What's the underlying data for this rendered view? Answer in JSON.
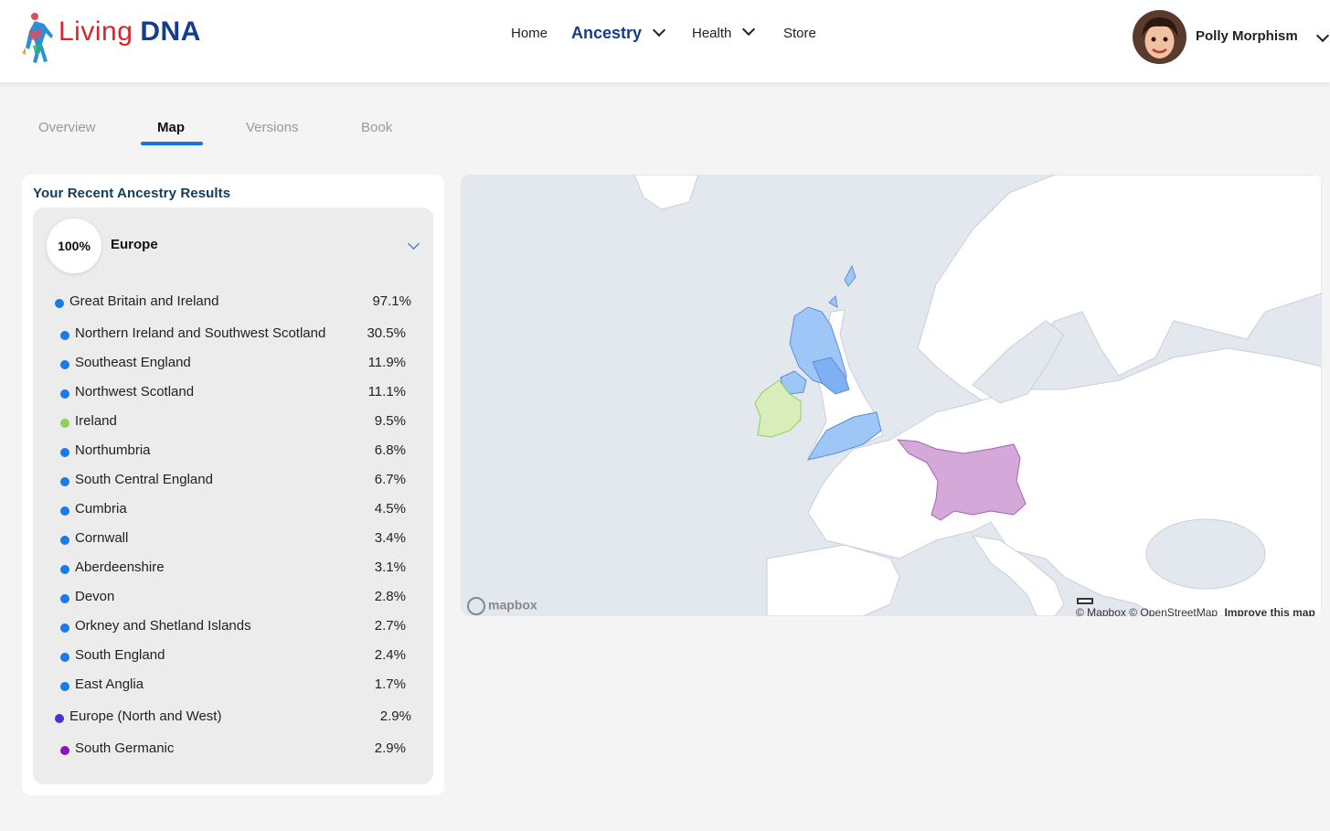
{
  "header": {
    "logo_part1": "Living",
    "logo_part2": "DNA",
    "nav": [
      {
        "label": "Home",
        "has_dropdown": false,
        "active": false
      },
      {
        "label": "Ancestry",
        "has_dropdown": true,
        "active": true
      },
      {
        "label": "Health",
        "has_dropdown": true,
        "active": false
      },
      {
        "label": "Store",
        "has_dropdown": false,
        "active": false
      }
    ],
    "user_name": "Polly Morphism"
  },
  "tabs": [
    "Overview",
    "Map",
    "Versions",
    "Book"
  ],
  "active_tab": "Map",
  "results": {
    "title": "Your Recent Ancestry Results",
    "region_percent": "100%",
    "region_name": "Europe",
    "groups": [
      {
        "name": "Great Britain and Ireland",
        "value": "97.1%",
        "color": "#1a7ae8"
      },
      {
        "name": "Northern Ireland and Southwest Scotland",
        "value": "30.5%",
        "color": "#1a7ae8"
      },
      {
        "name": "Southeast England",
        "value": "11.9%",
        "color": "#1a7ae8"
      },
      {
        "name": "Northwest Scotland",
        "value": "11.1%",
        "color": "#1a7ae8"
      },
      {
        "name": "Ireland",
        "value": "9.5%",
        "color": "#8fd15a"
      },
      {
        "name": "Northumbria",
        "value": "6.8%",
        "color": "#1a7ae8"
      },
      {
        "name": "South Central England",
        "value": "6.7%",
        "color": "#1a7ae8"
      },
      {
        "name": "Cumbria",
        "value": "4.5%",
        "color": "#1a7ae8"
      },
      {
        "name": "Cornwall",
        "value": "3.4%",
        "color": "#1a7ae8"
      },
      {
        "name": "Aberdeenshire",
        "value": "3.1%",
        "color": "#1a7ae8"
      },
      {
        "name": "Devon",
        "value": "2.8%",
        "color": "#1a7ae8"
      },
      {
        "name": "Orkney and Shetland Islands",
        "value": "2.7%",
        "color": "#1a7ae8"
      },
      {
        "name": "South England",
        "value": "2.4%",
        "color": "#1a7ae8"
      },
      {
        "name": "East Anglia",
        "value": "1.7%",
        "color": "#1a7ae8"
      },
      {
        "name": "Europe (North and West)",
        "value": "2.9%",
        "color": "#4b2fd6"
      },
      {
        "name": "South Germanic",
        "value": "2.9%",
        "color": "#8a15b8"
      }
    ]
  },
  "map": {
    "attribution_1": "© Mapbox",
    "attribution_2": "© OpenStreetMap",
    "improve_link": "Improve this map",
    "provider_logo": "mapbox"
  }
}
